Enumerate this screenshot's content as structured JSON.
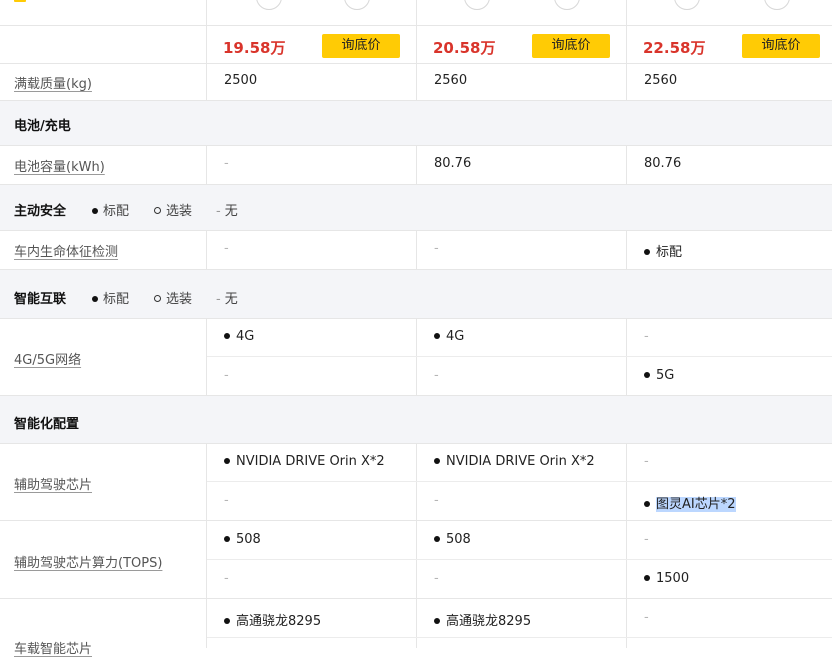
{
  "price_row": {
    "cars": [
      {
        "price": "19.58万",
        "button": "询底价"
      },
      {
        "price": "20.58万",
        "button": "询底价"
      },
      {
        "price": "22.58万",
        "button": "询底价"
      }
    ]
  },
  "rows": {
    "curb_weight": {
      "label": "满载质量(kg)",
      "values": [
        "2500",
        "2560",
        "2560"
      ]
    },
    "battery_capacity": {
      "label": "电池容量(kWh)",
      "values": [
        "-",
        "80.76",
        "80.76"
      ]
    },
    "vital_sign_detection": {
      "label": "车内生命体征检测",
      "values": [
        "-",
        "-",
        "标配"
      ]
    },
    "network": {
      "label": "4G/5G网络",
      "values": [
        [
          "4G",
          "-"
        ],
        [
          "4G",
          "-"
        ],
        [
          "-",
          "5G"
        ]
      ]
    },
    "adas_chip": {
      "label": "辅助驾驶芯片",
      "values": [
        [
          "NVIDIA DRIVE Orin X*2",
          "-"
        ],
        [
          "NVIDIA DRIVE Orin X*2",
          "-"
        ],
        [
          "-",
          "图灵AI芯片*2"
        ]
      ]
    },
    "adas_tops": {
      "label": "辅助驾驶芯片算力(TOPS)",
      "values": [
        [
          "508",
          "-"
        ],
        [
          "508",
          "-"
        ],
        [
          "-",
          "1500"
        ]
      ]
    },
    "cockpit_chip": {
      "label": "车载智能芯片",
      "values": [
        [
          "高通骁龙8295"
        ],
        [
          "高通骁龙8295"
        ],
        [
          "-"
        ]
      ]
    }
  },
  "sections": {
    "battery": {
      "title": "电池/充电"
    },
    "active_safety": {
      "title": "主动安全",
      "legend": [
        "标配",
        "选装",
        "无"
      ]
    },
    "connectivity": {
      "title": "智能互联",
      "legend": [
        "标配",
        "选装",
        "无"
      ]
    },
    "intelligence": {
      "title": "智能化配置"
    }
  },
  "colors": {
    "price": "#d9342b",
    "button_bg": "#ffcb05",
    "section_bg": "#f4f5f8",
    "selection_highlight": "#bcd7ff"
  }
}
